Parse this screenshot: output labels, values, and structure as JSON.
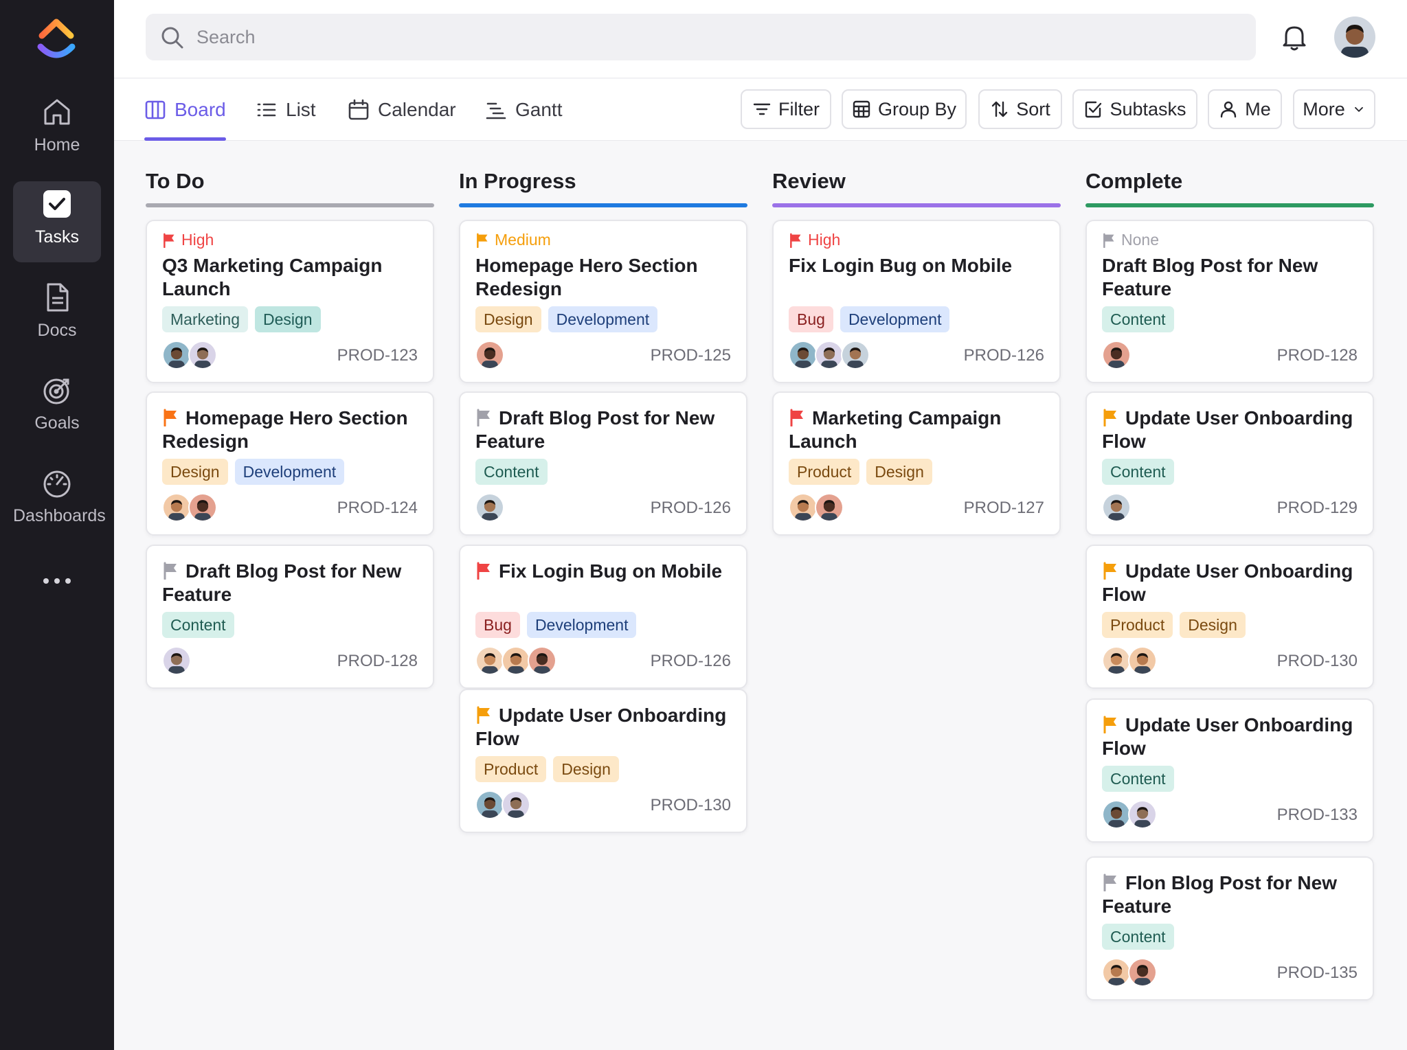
{
  "search": {
    "placeholder": "Search"
  },
  "sidebar": {
    "items": [
      {
        "label": "Home",
        "icon": "home-icon"
      },
      {
        "label": "Tasks",
        "icon": "tasks-icon",
        "active": true
      },
      {
        "label": "Docs",
        "icon": "docs-icon"
      },
      {
        "label": "Goals",
        "icon": "goals-icon"
      },
      {
        "label": "Dashboards",
        "icon": "dashboards-icon"
      }
    ]
  },
  "views": {
    "tabs": [
      {
        "label": "Board",
        "icon": "board-icon",
        "active": true
      },
      {
        "label": "List",
        "icon": "list-icon"
      },
      {
        "label": "Calendar",
        "icon": "calendar-icon"
      },
      {
        "label": "Gantt",
        "icon": "gantt-icon"
      }
    ],
    "buttons": [
      {
        "label": "Filter",
        "icon": "filter-icon"
      },
      {
        "label": "Group By",
        "icon": "grid-icon"
      },
      {
        "label": "Sort",
        "icon": "sort-icon"
      },
      {
        "label": "Subtasks",
        "icon": "checkbox-icon"
      },
      {
        "label": "Me",
        "icon": "user-icon"
      },
      {
        "label": "More",
        "icon": "chevron-down-icon"
      }
    ]
  },
  "colors": {
    "accent": "#6b5ce7",
    "todo": "#a9a9b1",
    "in_progress": "#1f7ae0",
    "review": "#9b72e8",
    "complete": "#2e9a62",
    "priority_high": "#ef4444",
    "priority_medium": "#f59e0b",
    "priority_none": "#a1a1aa"
  },
  "columns": [
    {
      "title": "To Do",
      "cards": [
        {
          "priority": "High",
          "priority_color": "#ef4444",
          "title": "Q3 Marketing Campaign Launch",
          "tags": [
            "Marketing",
            "Design"
          ],
          "id": "PROD-123",
          "avatars": 2
        },
        {
          "flag_color": "#f97316",
          "title": "Homepage Hero Section Redesign",
          "tags": [
            "Design",
            "Development"
          ],
          "id": "PROD-124",
          "avatars": 2
        },
        {
          "flag_color": "#a1a1aa",
          "title": "Draft Blog Post for New Feature",
          "tags": [
            "Content"
          ],
          "id": "PROD-128",
          "avatars": 1
        }
      ]
    },
    {
      "title": "In Progress",
      "cards": [
        {
          "priority": "Medium",
          "priority_color": "#f59e0b",
          "title": "Homepage Hero Section Redesign",
          "tags": [
            "Design",
            "Development"
          ],
          "id": "PROD-125",
          "avatars": 1
        },
        {
          "flag_color": "#a1a1aa",
          "title": "Draft Blog Post for New Feature",
          "tags": [
            "Content"
          ],
          "id": "PROD-126",
          "avatars": 1
        },
        {
          "flag_color": "#ef4444",
          "title": "Fix Login Bug on Mobile",
          "tags": [
            "Bug",
            "Development"
          ],
          "id": "PROD-126",
          "avatars": 3
        },
        {
          "flag_color": "#f59e0b",
          "title": "Update User Onboarding Flow",
          "tags": [
            "Product",
            "Design"
          ],
          "id": "PROD-130",
          "avatars": 2
        }
      ]
    },
    {
      "title": "Review",
      "cards": [
        {
          "priority": "High",
          "priority_color": "#ef4444",
          "title": "Fix Login Bug on Mobile",
          "tags": [
            "Bug",
            "Development"
          ],
          "id": "PROD-126",
          "avatars": 3
        },
        {
          "flag_color": "#ef4444",
          "title": "Marketing Campaign Launch",
          "tags": [
            "Product",
            "Design"
          ],
          "id": "PROD-127",
          "avatars": 2
        }
      ]
    },
    {
      "title": "Complete",
      "cards": [
        {
          "priority": "None",
          "priority_color": "#a1a1aa",
          "title": "Draft Blog Post for New Feature",
          "tags": [
            "Content"
          ],
          "id": "PROD-128",
          "avatars": 1
        },
        {
          "flag_color": "#f59e0b",
          "title": "Update User Onboarding Flow",
          "tags": [
            "Content"
          ],
          "id": "PROD-129",
          "avatars": 1
        },
        {
          "flag_color": "#f59e0b",
          "title": "Update User Onboarding Flow",
          "tags": [
            "Product",
            "Design"
          ],
          "id": "PROD-130",
          "avatars": 2
        },
        {
          "flag_color": "#f59e0b",
          "title": "Update User Onboarding Flow",
          "tags": [
            "Content"
          ],
          "id": "PROD-133",
          "avatars": 2
        },
        {
          "flag_color": "#a1a1aa",
          "title": "Flon Blog Post for New Feature",
          "tags": [
            "Content"
          ],
          "id": "PROD-135",
          "avatars": 2
        }
      ]
    }
  ]
}
